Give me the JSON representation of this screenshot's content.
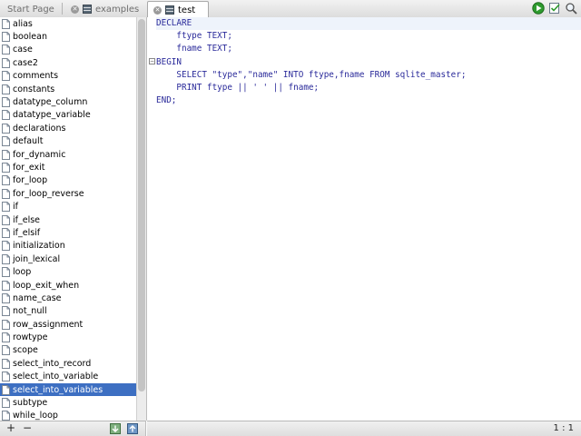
{
  "tabs": [
    {
      "label": "Start Page",
      "icon": "none",
      "active": false
    },
    {
      "label": "examples",
      "icon": "database-icon",
      "active": false
    },
    {
      "label": "test",
      "icon": "database-icon",
      "active": true
    }
  ],
  "toolbar": {
    "run_icon": "run-icon",
    "check_icon": "check-icon",
    "search_icon": "search-icon",
    "run_color": "#2e9b2e"
  },
  "sidebar": {
    "items": [
      "alias",
      "boolean",
      "case",
      "case2",
      "comments",
      "constants",
      "datatype_column",
      "datatype_variable",
      "declarations",
      "default",
      "for_dynamic",
      "for_exit",
      "for_loop",
      "for_loop_reverse",
      "if",
      "if_else",
      "if_elsif",
      "initialization",
      "join_lexical",
      "loop",
      "loop_exit_when",
      "name_case",
      "not_null",
      "row_assignment",
      "rowtype",
      "scope",
      "select_into_record",
      "select_into_variable",
      "select_into_variables",
      "subtype",
      "while_loop"
    ],
    "selected_index": 28,
    "selection_color": "#3d6fc2",
    "footer": {
      "add_label": "+",
      "remove_label": "−"
    }
  },
  "editor": {
    "lines": [
      "DECLARE",
      "    ftype TEXT;",
      "    fname TEXT;",
      "BEGIN",
      "    SELECT \"type\",\"name\" INTO ftype,fname FROM sqlite_master;",
      "    PRINT ftype || ' ' || fname;",
      "END;"
    ],
    "fold_marker": "−"
  },
  "status": {
    "cursor": "1 : 1"
  }
}
